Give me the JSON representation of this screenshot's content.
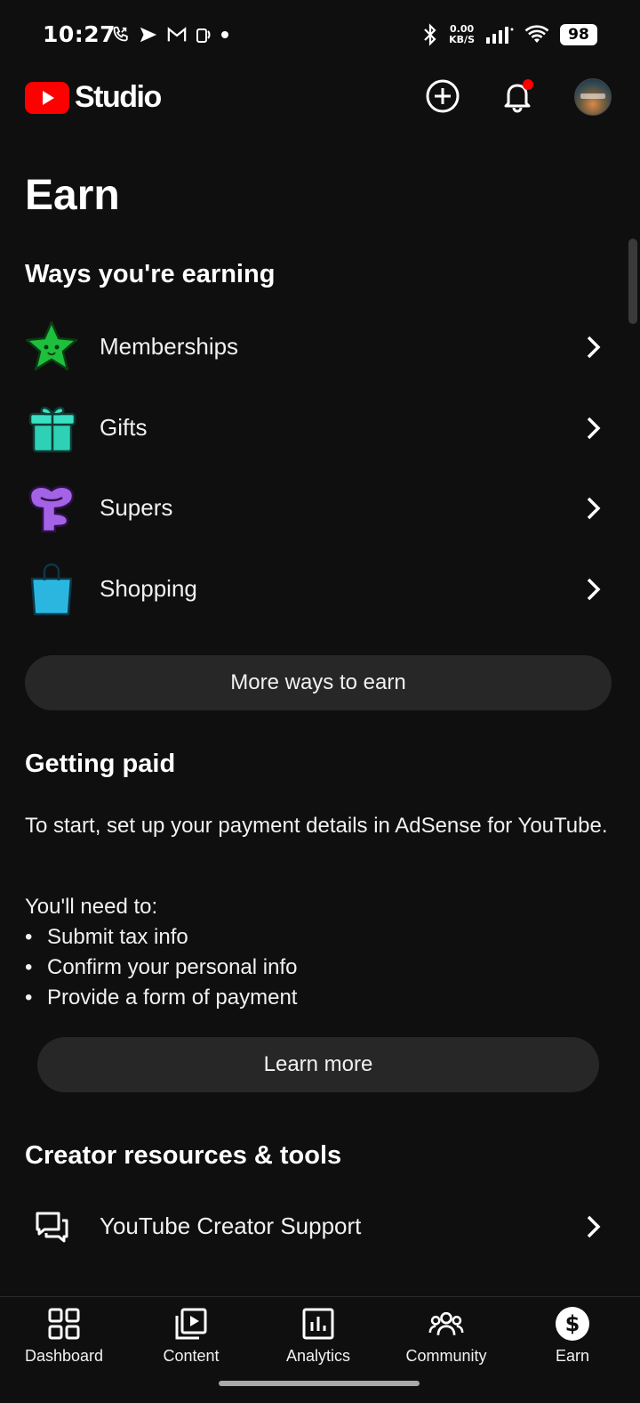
{
  "status_bar": {
    "time": "10:27",
    "net_speed_value": "0.00",
    "net_speed_unit": "KB/S",
    "battery": "98"
  },
  "app_bar": {
    "logo_text": "Studio"
  },
  "page": {
    "title": "Earn"
  },
  "ways_section": {
    "title": "Ways you're earning",
    "items": [
      {
        "label": "Memberships",
        "icon": "star-icon"
      },
      {
        "label": "Gifts",
        "icon": "gift-icon"
      },
      {
        "label": "Supers",
        "icon": "supers-icon"
      },
      {
        "label": "Shopping",
        "icon": "shopping-bag-icon"
      }
    ],
    "more_button": "More ways to earn"
  },
  "paid_section": {
    "title": "Getting paid",
    "intro": "To start, set up your payment details in AdSense for YouTube.",
    "need_label": "You'll need to:",
    "bullets": [
      "Submit tax info",
      "Confirm your personal info",
      "Provide a form of payment"
    ],
    "learn_more": "Learn more"
  },
  "resources_section": {
    "title": "Creator resources & tools",
    "items": [
      {
        "label": "YouTube Creator Support",
        "icon": "chat-icon"
      }
    ]
  },
  "bottom_nav": {
    "items": [
      {
        "label": "Dashboard",
        "icon": "dashboard-icon"
      },
      {
        "label": "Content",
        "icon": "content-icon"
      },
      {
        "label": "Analytics",
        "icon": "analytics-icon"
      },
      {
        "label": "Community",
        "icon": "community-icon"
      },
      {
        "label": "Earn",
        "icon": "earn-icon"
      }
    ],
    "active": "Earn"
  },
  "colors": {
    "background": "#0f0f0f",
    "surface": "#272727",
    "brand_red": "#ff0000",
    "notification_dot": "#ff0000"
  }
}
